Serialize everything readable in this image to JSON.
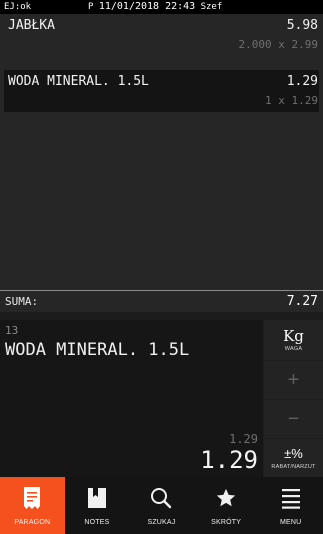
{
  "status_bar": {
    "left": "EJ:ok",
    "prefix": "P",
    "datetime": "11/01/2018 22:43",
    "user": "Szef"
  },
  "receipt": {
    "lines": [
      {
        "name": "JABŁKA",
        "amount": "5.98",
        "qty": "2.000 x 2.99"
      },
      {
        "name": "WODA MINERAL. 1.5L",
        "amount": "1.29",
        "qty": "1 x 1.29"
      }
    ],
    "selected_index": 1
  },
  "summary": {
    "label": "SUMA:",
    "value": "7.27"
  },
  "detail": {
    "code": "13",
    "name": "WODA MINERAL. 1.5L",
    "price_small": "1.29",
    "price_big": "1.29"
  },
  "side_buttons": {
    "kg_main": "Kg",
    "kg_sub": "WAGA",
    "plus": "+",
    "minus": "−",
    "rabat_main": "±%",
    "rabat_sub": "RABAT/NARZUT"
  },
  "nav": {
    "items": [
      {
        "label": "PARAGON",
        "icon": "receipt-icon",
        "active": true
      },
      {
        "label": "NOTES",
        "icon": "notes-icon",
        "active": false
      },
      {
        "label": "SZUKAJ",
        "icon": "search-icon",
        "active": false
      },
      {
        "label": "SKRÓTY",
        "icon": "star-icon",
        "active": false
      },
      {
        "label": "MENU",
        "icon": "menu-icon",
        "active": false
      }
    ]
  },
  "colors": {
    "accent": "#f4511e",
    "background": "#262626",
    "dark": "#141414"
  }
}
